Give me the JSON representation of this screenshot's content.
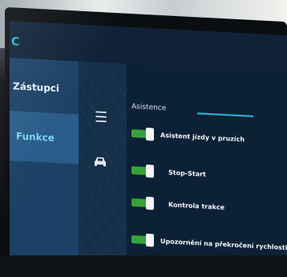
{
  "header": {
    "partial_letter": "C"
  },
  "sidebar": {
    "items": [
      {
        "label": "Zástupci"
      },
      {
        "label": "Funkce"
      }
    ]
  },
  "icons": {
    "menu": "menu-icon",
    "car": "car-icon"
  },
  "panel": {
    "title": "Asistence",
    "rows": [
      {
        "label": "Asistent jízdy v pruzích",
        "enabled": true
      },
      {
        "label": "Stop-Start",
        "enabled": true
      },
      {
        "label": "Kontrola trakce",
        "enabled": true
      },
      {
        "label": "Upozornění na překročení rychlosti",
        "enabled": true
      }
    ]
  },
  "colors": {
    "toggle_on": "#39a13c",
    "accent": "#2fb6d8",
    "selected_text": "#7fd2f2"
  }
}
